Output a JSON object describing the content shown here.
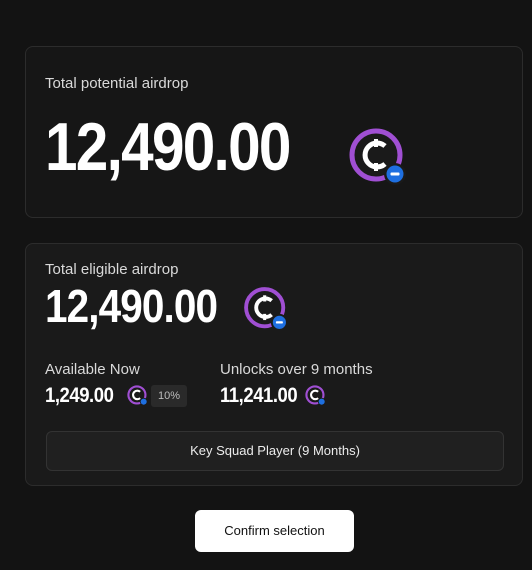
{
  "total_potential": {
    "label": "Total potential airdrop",
    "amount": "12,490.00",
    "token_icon": "coin-token-icon"
  },
  "total_eligible": {
    "label": "Total eligible airdrop",
    "amount": "12,490.00",
    "token_icon": "coin-token-icon"
  },
  "available_now": {
    "label": "Available Now",
    "amount": "1,249.00",
    "percent": "10%"
  },
  "unlocks": {
    "label": "Unlocks over 9 months",
    "amount": "11,241.00"
  },
  "tier_option": {
    "label": "Key Squad Player (9 Months)"
  },
  "confirm": {
    "label": "Confirm selection"
  },
  "colors": {
    "background": "#131313",
    "card_border": "#2c2c2c",
    "coin_ring": "#a04fd3",
    "coin_badge": "#1e6fe0",
    "confirm_bg": "#ffffff"
  }
}
